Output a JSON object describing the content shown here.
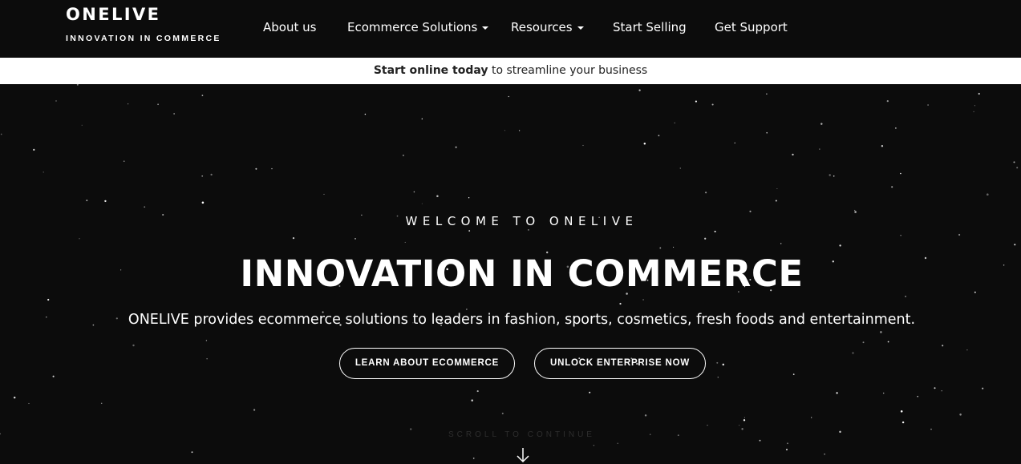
{
  "brand": {
    "name": "ONELIVE",
    "tagline": "INNOVATION IN COMMERCE"
  },
  "nav": {
    "items": [
      {
        "label": "About us",
        "dropdown": false
      },
      {
        "label": "Ecommerce Solutions",
        "dropdown": true
      },
      {
        "label": "Resources",
        "dropdown": true
      },
      {
        "label": "Start Selling",
        "dropdown": false
      },
      {
        "label": "Get Support",
        "dropdown": false
      }
    ]
  },
  "announcement": {
    "bold": "Start online today",
    "rest": " to streamline your business"
  },
  "hero": {
    "welcome": "WELCOME TO ONELIVE",
    "headline": "INNOVATION IN COMMERCE",
    "subline": "ONELIVE provides ecommerce solutions to leaders in fashion, sports, cosmetics, fresh foods and entertainment.",
    "buttons": {
      "learn": "LEARN ABOUT ECOMMERCE",
      "unlock": "UNLOCK ENTERPRISE NOW"
    },
    "scroll_label": "SCROLL TO CONTINUE",
    "scroll_icon": "arrow-down-icon"
  },
  "colors": {
    "background": "#0c0c0c",
    "announcement_bg": "#ffffff",
    "text": "#ffffff"
  }
}
